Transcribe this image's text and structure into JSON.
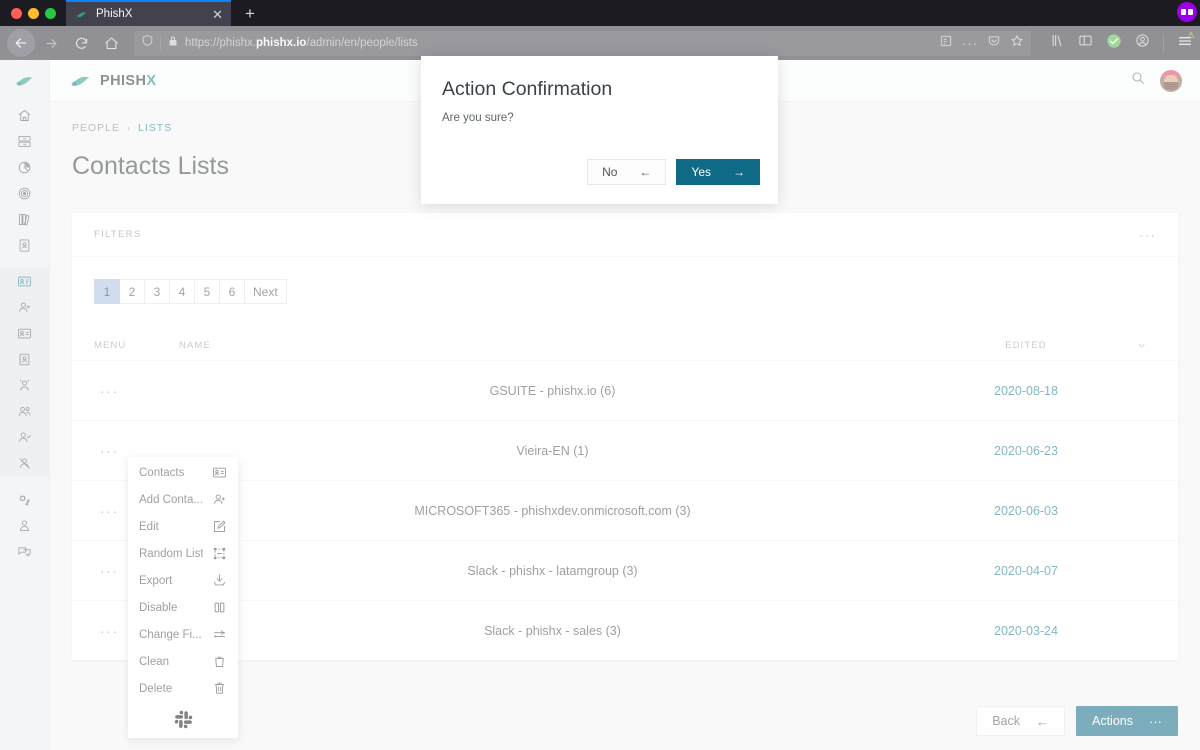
{
  "browser": {
    "tab": {
      "title": "PhishX",
      "favicon": "phishx-logo-icon",
      "close_label": "✕"
    },
    "new_tab_label": "+",
    "url": {
      "prefix": "https://phishx.",
      "domain": "phishx.io",
      "path": "/admin/en/people/lists"
    },
    "nav": {
      "back": "back-arrow-icon",
      "forward": "forward-arrow-icon",
      "reload": "reload-icon",
      "home": "home-icon"
    },
    "url_icons": [
      "shield-icon",
      "lock-icon",
      "reader-view-icon",
      "page-actions-icon",
      "pocket-icon",
      "bookmark-star-icon"
    ],
    "toolbar_icons": [
      "library-icon",
      "sidebar-icon",
      "sync-check-icon",
      "account-icon",
      "menu-icon"
    ]
  },
  "sidebar": {
    "logo": "phishx-mini-logo-icon",
    "groups": [
      {
        "active": false,
        "items": [
          {
            "name": "sidebar-item-home",
            "icon": "home-icon"
          },
          {
            "name": "sidebar-item-servers",
            "icon": "server-icon"
          },
          {
            "name": "sidebar-item-analytics",
            "icon": "pie-chart-icon"
          },
          {
            "name": "sidebar-item-targets",
            "icon": "target-icon"
          },
          {
            "name": "sidebar-item-library",
            "icon": "books-icon"
          },
          {
            "name": "sidebar-item-contacts-book",
            "icon": "address-book-icon"
          }
        ]
      },
      {
        "active": true,
        "items": [
          {
            "name": "sidebar-item-lists",
            "icon": "contact-card-icon"
          },
          {
            "name": "sidebar-item-add-person",
            "icon": "user-add-icon"
          },
          {
            "name": "sidebar-item-badges",
            "icon": "id-card-icon"
          },
          {
            "name": "sidebar-item-groups",
            "icon": "group-icon"
          },
          {
            "name": "sidebar-item-id",
            "icon": "id-badge-icon"
          },
          {
            "name": "sidebar-item-team",
            "icon": "people-icon"
          },
          {
            "name": "sidebar-item-approved-user",
            "icon": "user-check-icon"
          },
          {
            "name": "sidebar-item-blocked-user",
            "icon": "user-blocked-icon"
          }
        ]
      },
      {
        "active": false,
        "items": [
          {
            "name": "sidebar-item-settings",
            "icon": "gear-network-icon"
          },
          {
            "name": "sidebar-item-profile",
            "icon": "user-profile-icon"
          },
          {
            "name": "sidebar-item-chat",
            "icon": "chat-icon"
          }
        ]
      }
    ]
  },
  "topbar": {
    "brand_prefix": "PHISH",
    "brand_suffix": "X",
    "search_icon": "search-icon",
    "avatar": "user-avatar"
  },
  "breadcrumb": {
    "parent": "PEOPLE",
    "separator": "›",
    "current": "LISTS"
  },
  "page": {
    "title": "Contacts Lists"
  },
  "filters": {
    "label": "FILTERS",
    "more": "···"
  },
  "pagination": {
    "pages": [
      "1",
      "2",
      "3",
      "4",
      "5",
      "6"
    ],
    "active": "1",
    "next_label": "Next"
  },
  "table": {
    "columns": {
      "menu": "MENU",
      "name": "NAME",
      "edited": "EDITED"
    },
    "sort_icon": "chevron-down-icon",
    "row_menu_icon": "···",
    "rows": [
      {
        "name": "GSUITE - phishx.io (6)",
        "edited": "2020-08-18"
      },
      {
        "name": "Vieira-EN (1)",
        "edited": "2020-06-23"
      },
      {
        "name": "MICROSOFT365 - phishxdev.onmicrosoft.com (3)",
        "edited": "2020-06-03"
      },
      {
        "name": "Slack - phishx - latamgroup (3)",
        "edited": "2020-04-07"
      },
      {
        "name": "Slack - phishx - sales (3)",
        "edited": "2020-03-24"
      }
    ]
  },
  "context_menu": {
    "items": [
      {
        "label": "Contacts",
        "icon": "contact-card-icon"
      },
      {
        "label": "Add Conta...",
        "icon": "user-add-icon"
      },
      {
        "label": "Edit",
        "icon": "edit-pencil-icon"
      },
      {
        "label": "Random List",
        "icon": "random-list-icon"
      },
      {
        "label": "Export",
        "icon": "export-download-icon"
      },
      {
        "label": "Disable",
        "icon": "pause-icon"
      },
      {
        "label": "Change Fi...",
        "icon": "change-filter-icon"
      },
      {
        "label": "Clean",
        "icon": "trash-open-icon"
      },
      {
        "label": "Delete",
        "icon": "trash-icon"
      }
    ],
    "footer_icon": "slack-logo-icon"
  },
  "footer": {
    "back_label": "Back",
    "back_icon": "←",
    "actions_label": "Actions",
    "actions_icon": "···"
  },
  "modal": {
    "title": "Action Confirmation",
    "message": "Are you sure?",
    "no_label": "No",
    "no_icon": "←",
    "yes_label": "Yes",
    "yes_icon": "→"
  },
  "colors": {
    "accent": "#0f6a87",
    "link": "#1d7e94",
    "brand_teal": "#1b8a8f",
    "pager_active": "#a8c2e0"
  }
}
